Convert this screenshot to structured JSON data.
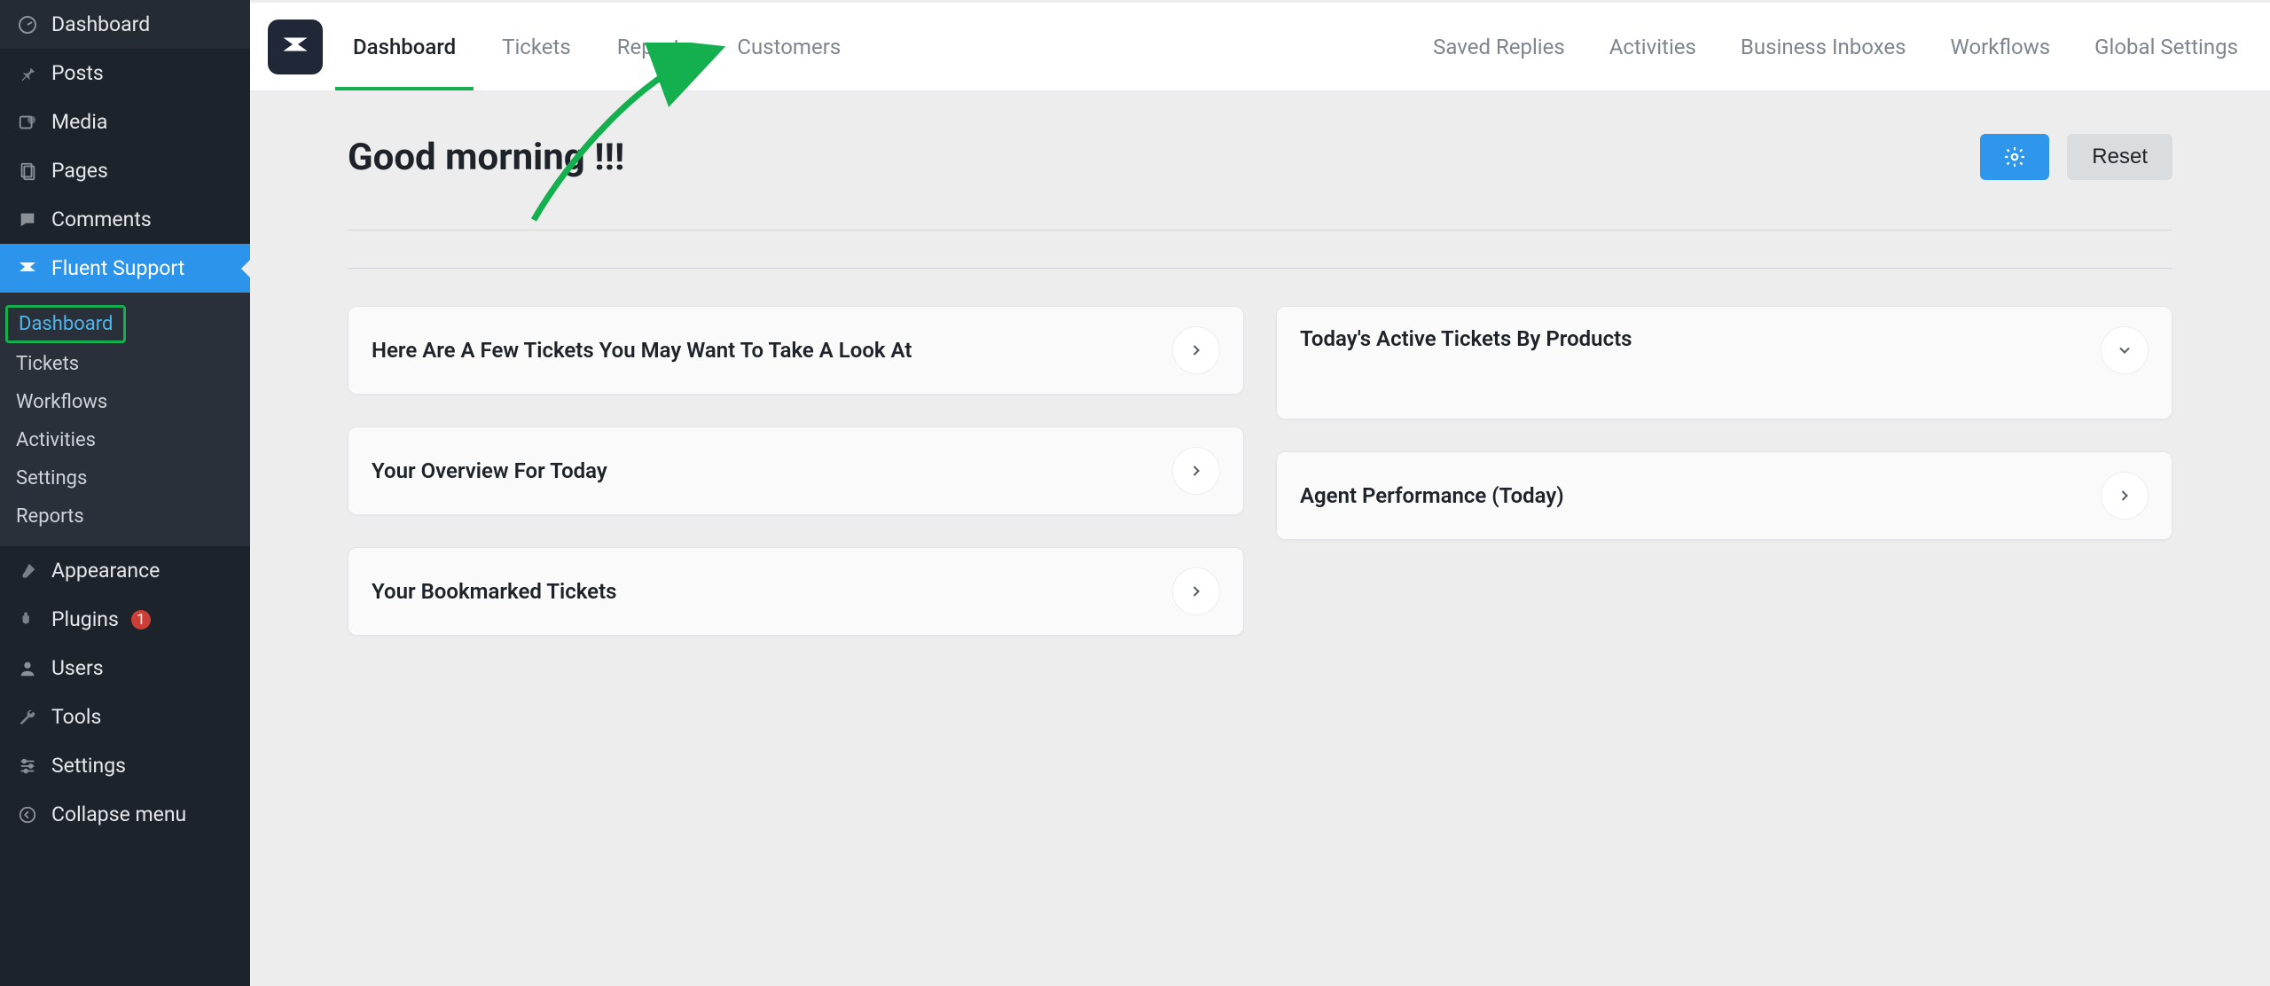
{
  "sidebar": {
    "items": [
      {
        "label": "Dashboard"
      },
      {
        "label": "Posts"
      },
      {
        "label": "Media"
      },
      {
        "label": "Pages"
      },
      {
        "label": "Comments"
      },
      {
        "label": "Fluent Support"
      },
      {
        "label": "Appearance"
      },
      {
        "label": "Plugins",
        "badge": "1"
      },
      {
        "label": "Users"
      },
      {
        "label": "Tools"
      },
      {
        "label": "Settings"
      },
      {
        "label": "Collapse menu"
      }
    ],
    "submenu": [
      {
        "label": "Dashboard"
      },
      {
        "label": "Tickets"
      },
      {
        "label": "Workflows"
      },
      {
        "label": "Activities"
      },
      {
        "label": "Settings"
      },
      {
        "label": "Reports"
      }
    ]
  },
  "header": {
    "primary": [
      {
        "label": "Dashboard"
      },
      {
        "label": "Tickets"
      },
      {
        "label": "Reports"
      },
      {
        "label": "Customers"
      }
    ],
    "secondary": [
      {
        "label": "Saved Replies"
      },
      {
        "label": "Activities"
      },
      {
        "label": "Business Inboxes"
      },
      {
        "label": "Workflows"
      },
      {
        "label": "Global Settings"
      }
    ]
  },
  "greeting": "Good morning !!!",
  "actions": {
    "reset": "Reset"
  },
  "panels": {
    "look_at": "Here Are A Few Tickets You May Want To Take A Look At",
    "overview": "Your Overview For Today",
    "bookmarked": "Your Bookmarked Tickets",
    "active_products": "Today's Active Tickets By Products",
    "agent_perf": "Agent Performance (Today)"
  }
}
